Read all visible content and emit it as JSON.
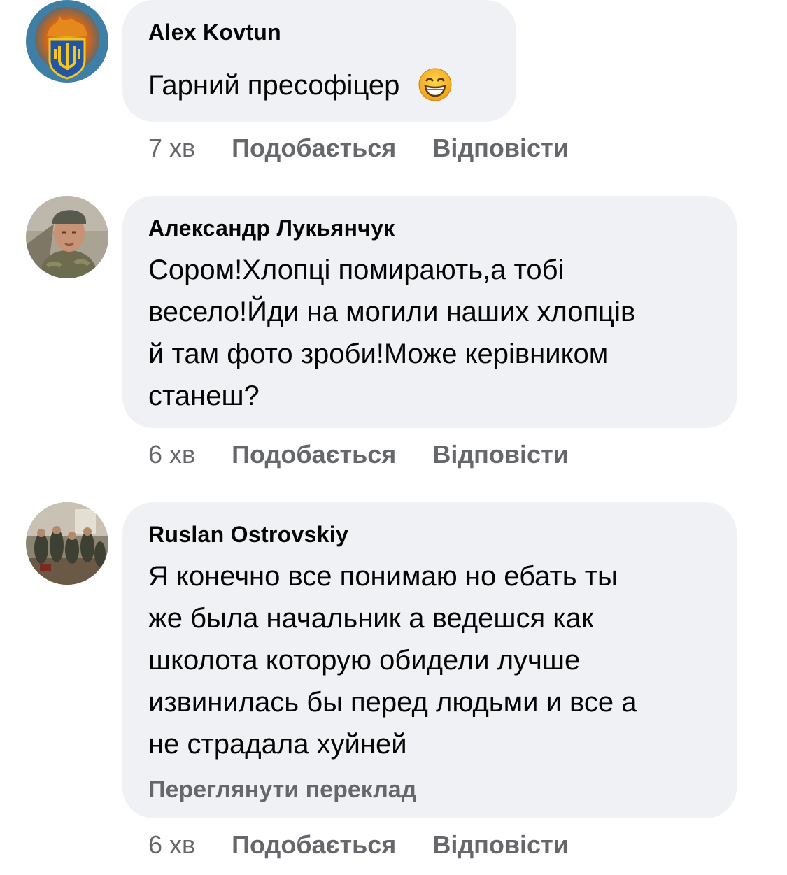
{
  "comments": [
    {
      "author": "Alex  Kovtun",
      "text_lines": [
        "Гарний пресофіцер"
      ],
      "emoji": "grinning-face-icon",
      "time": "7 хв",
      "like": "Подобається",
      "reply": "Відповісти"
    },
    {
      "author": "Александр Лукьянчук",
      "text_lines": [
        "Сором!Хлопці помирають,а тобі",
        "весело!Йди на могили наших хлопців",
        "й там фото зроби!Може керівником",
        "станеш?"
      ],
      "time": "6 хв",
      "like": "Подобається",
      "reply": "Відповісти"
    },
    {
      "author": "Ruslan Ostrovskiy",
      "text_lines": [
        "Я конечно все понимаю но ебать ты",
        "же была начальник а ведешся как",
        "школота которую обидели лучше",
        "извинилась бы перед людьми и все а",
        "не страдала хуйней"
      ],
      "translate": "Переглянути переклад",
      "time": "6 хв",
      "like": "Подобається",
      "reply": "Відповісти"
    }
  ],
  "colors": {
    "bubble": "#f0f1f4",
    "secondary_text": "#65676b",
    "primary_text": "#050505"
  }
}
